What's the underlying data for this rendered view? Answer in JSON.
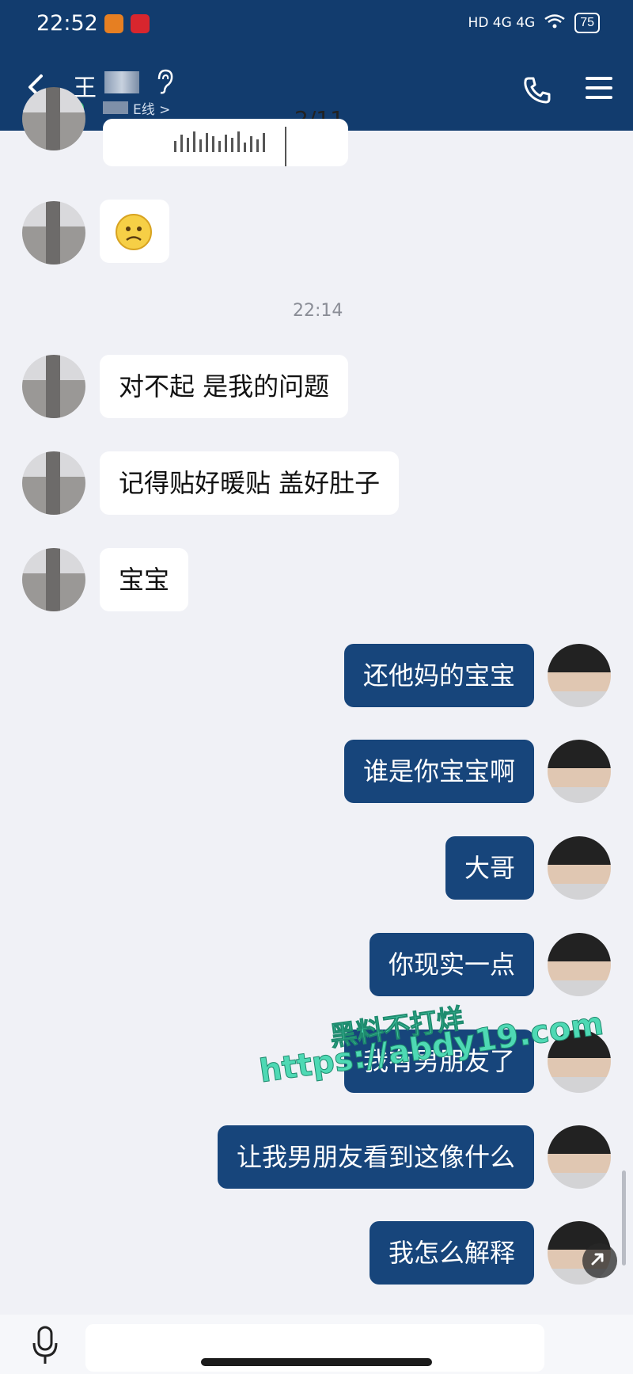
{
  "status_bar": {
    "time": "22:52",
    "network": "HD 4G 4G",
    "battery": "75"
  },
  "header": {
    "contact_name_visible": "王",
    "online_status": "E线 >",
    "colors": {
      "background": "#123c6e",
      "accent_online": "#2dbf73"
    },
    "icons": [
      "back-arrow-icon",
      "ear-icon",
      "phone-icon",
      "menu-icon"
    ]
  },
  "viewer": {
    "page_counter": "2/11",
    "close_glyph": "✕"
  },
  "timestamp": "22:14",
  "messages_incoming": [
    {
      "text": "对不起 是我的问题"
    },
    {
      "text": "记得贴好暖贴  盖好肚子"
    },
    {
      "text": "宝宝"
    }
  ],
  "messages_outgoing": [
    {
      "text": "还他妈的宝宝"
    },
    {
      "text": "谁是你宝宝啊"
    },
    {
      "text": "大哥"
    },
    {
      "text": "你现实一点"
    },
    {
      "text": "我有男朋友了"
    },
    {
      "text": "让我男朋友看到这像什么"
    },
    {
      "text": "我怎么解释"
    }
  ],
  "watermark": {
    "line1": "黑料不打烊",
    "line2": "https://abdy19.com"
  },
  "colors": {
    "chat_background": "#f0f1f6",
    "bubble_incoming": "#ffffff",
    "bubble_outgoing": "#17457b"
  }
}
